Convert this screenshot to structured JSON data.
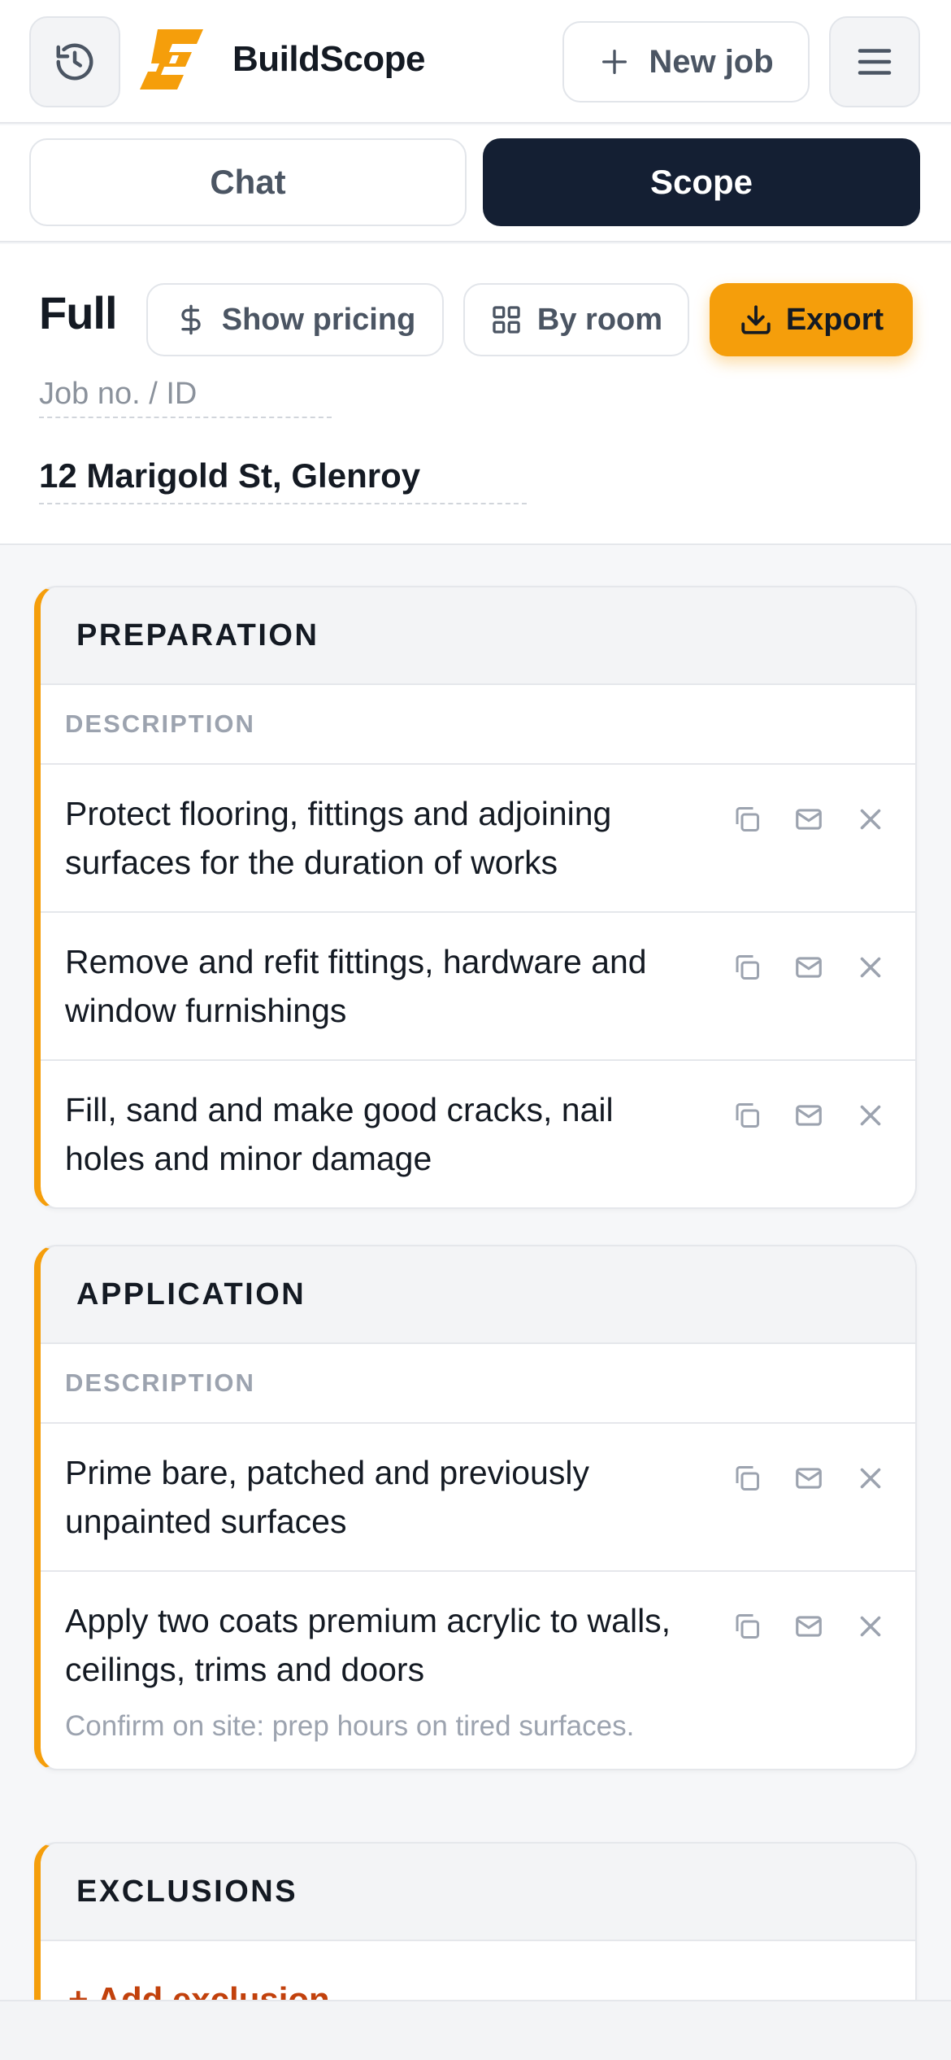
{
  "header": {
    "brand": "BuildScope",
    "new_job_label": "New job",
    "icons": [
      "history-icon",
      "plus-icon",
      "menu-icon"
    ]
  },
  "tabs": [
    {
      "label": "Chat",
      "active": false
    },
    {
      "label": "Scope",
      "active": true
    }
  ],
  "toolbar": {
    "view_title": "Full",
    "pricing_label": "Show pricing",
    "by_room_label": "By room",
    "export_label": "Export"
  },
  "job": {
    "id_placeholder": "Job no. / ID",
    "address": "12 Marigold St, Glenroy"
  },
  "sections": [
    {
      "title": "PREPARATION",
      "column": "DESCRIPTION",
      "items": [
        {
          "text": "Protect flooring, fittings and adjoining surfaces for the duration of works"
        },
        {
          "text": "Remove and refit fittings, hardware and window furnishings"
        },
        {
          "text": "Fill, sand and make good cracks, nail holes and minor damage"
        }
      ]
    },
    {
      "title": "APPLICATION",
      "column": "DESCRIPTION",
      "items": [
        {
          "text": "Prime bare, patched and previously unpainted surfaces"
        },
        {
          "text": "Apply two coats premium acrylic to walls, ceilings, trims and doors",
          "note": "Confirm on site: prep hours on tired surfaces."
        }
      ]
    },
    {
      "title": "EXCLUSIONS",
      "add_label": "+ Add exclusion"
    }
  ],
  "colors": {
    "accent": "#f59e0b",
    "dark": "#141f33",
    "link": "#c2410c"
  }
}
